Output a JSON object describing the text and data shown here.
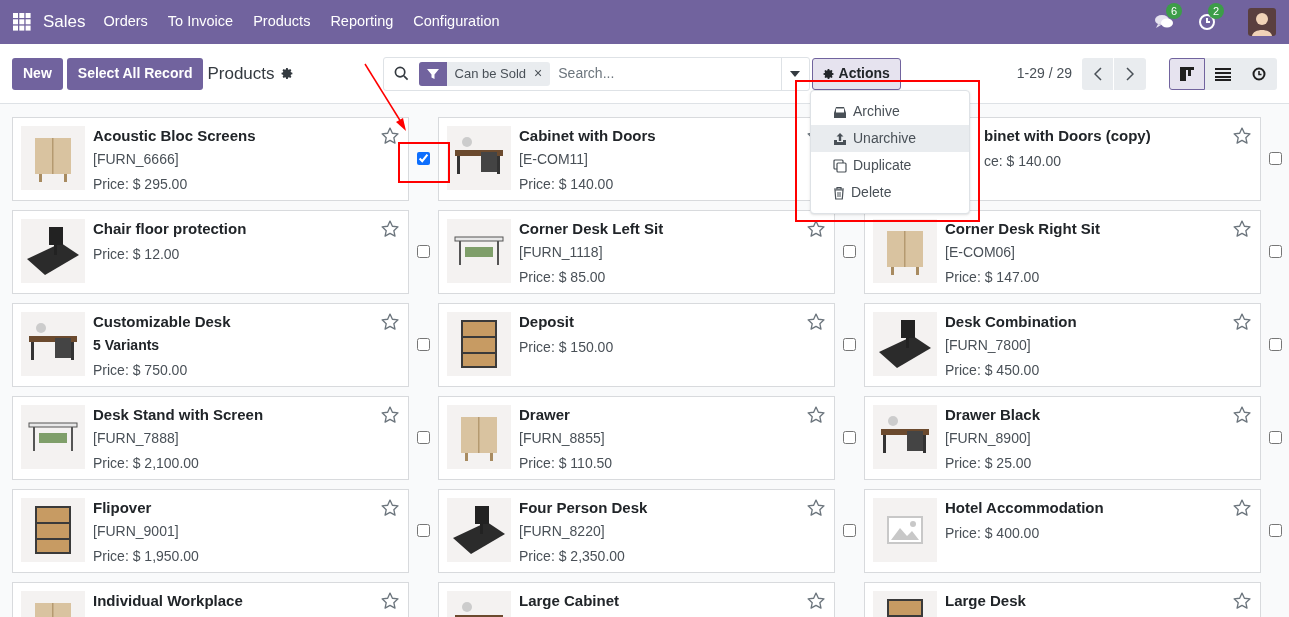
{
  "navbar": {
    "app": "Sales",
    "menu": [
      "Orders",
      "To Invoice",
      "Products",
      "Reporting",
      "Configuration"
    ],
    "messages_badge": "6",
    "activities_badge": "2"
  },
  "control_panel": {
    "buttons": [
      "New",
      "Select All Record"
    ],
    "title": "Products",
    "filter": "Can be Sold",
    "facet_remove": "×",
    "search_placeholder": "Search...",
    "actions": "Actions",
    "pager": "1-29 / 29",
    "views": [
      {
        "kind": "kanban",
        "selected": true
      },
      {
        "kind": "list",
        "selected": false
      },
      {
        "kind": "activity",
        "selected": false
      }
    ]
  },
  "actions_menu": [
    {
      "kind": "archive",
      "label": "Archive",
      "active": false
    },
    {
      "kind": "unarchive",
      "label": "Unarchive",
      "active": true
    },
    {
      "kind": "duplicate",
      "label": "Duplicate",
      "active": false
    },
    {
      "kind": "delete",
      "label": "Delete",
      "active": false
    }
  ],
  "cards": [
    {
      "kind": "product",
      "name": "Acoustic Bloc Screens",
      "subtitle": "[FURN_6666]",
      "price": "Price: $ 295.00",
      "checked": true
    },
    {
      "kind": "product",
      "name": "Cabinet with Doors",
      "subtitle": "[E-COM11]",
      "price": "Price: $ 140.00"
    },
    {
      "kind": "covered",
      "name": "binet with Doors (copy)",
      "price": "ce: $ 140.00",
      "checked": false
    },
    {
      "kind": "product",
      "name": "Chair floor protection",
      "price": "Price: $ 12.00",
      "checked": false
    },
    {
      "kind": "product",
      "name": "Corner Desk Left Sit",
      "subtitle": "[FURN_1118]",
      "price": "Price: $ 85.00",
      "checked": false
    },
    {
      "kind": "product",
      "name": "Corner Desk Right Sit",
      "subtitle": "[E-COM06]",
      "price": "Price: $ 147.00",
      "checked": false
    },
    {
      "kind": "product",
      "name": "Customizable Desk",
      "variants": "5 Variants",
      "price": "Price: $ 750.00",
      "checked": false
    },
    {
      "kind": "product",
      "name": "Deposit",
      "price": "Price: $ 150.00",
      "checked": false
    },
    {
      "kind": "product",
      "name": "Desk Combination",
      "subtitle": "[FURN_7800]",
      "price": "Price: $ 450.00",
      "checked": false
    },
    {
      "kind": "product",
      "name": "Desk Stand with Screen",
      "subtitle": "[FURN_7888]",
      "price": "Price: $ 2,100.00",
      "checked": false
    },
    {
      "kind": "product",
      "name": "Drawer",
      "subtitle": "[FURN_8855]",
      "price": "Price: $ 110.50",
      "checked": false
    },
    {
      "kind": "product",
      "name": "Drawer Black",
      "subtitle": "[FURN_8900]",
      "price": "Price: $ 25.00",
      "checked": false
    },
    {
      "kind": "product",
      "name": "Flipover",
      "subtitle": "[FURN_9001]",
      "price": "Price: $ 1,950.00",
      "checked": false
    },
    {
      "kind": "product",
      "name": "Four Person Desk",
      "subtitle": "[FURN_8220]",
      "price": "Price: $ 2,350.00",
      "checked": false
    },
    {
      "kind": "placeholder",
      "name": "Hotel Accommodation",
      "price": "Price: $ 400.00",
      "checked": false
    },
    {
      "kind": "product",
      "name": "Individual Workplace"
    },
    {
      "kind": "product",
      "name": "Large Cabinet"
    },
    {
      "kind": "product",
      "name": "Large Desk"
    }
  ]
}
